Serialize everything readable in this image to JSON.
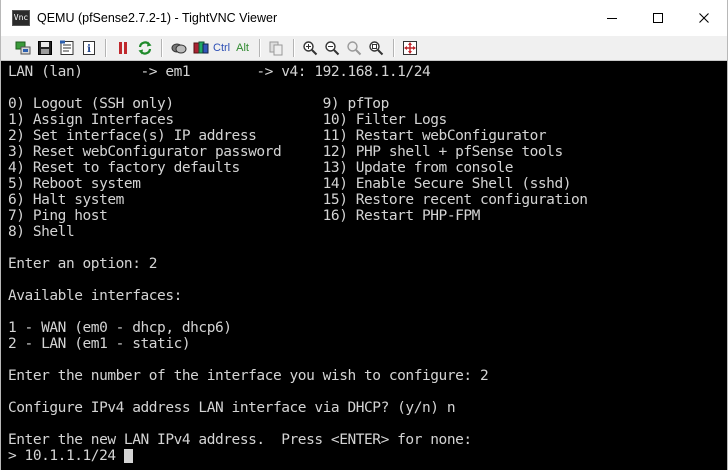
{
  "window": {
    "title": "QEMU (pfSense2.7.2-1) - TightVNC Viewer",
    "app_icon_text": "Vnc"
  },
  "toolbar": {
    "buttons": [
      "new-connection-icon",
      "save-icon",
      "options-icon",
      "info-icon",
      "pause-icon",
      "refresh-icon",
      "transfer-icon",
      "ctrl-alt-del-icon"
    ],
    "ctrl_label": "Ctrl",
    "alt_label": "Alt",
    "zoom_buttons": [
      "clipboard-icon",
      "zoom-in-icon",
      "zoom-out-icon",
      "zoom-100-icon",
      "zoom-fit-icon",
      "fullscreen-icon"
    ]
  },
  "console": {
    "lines": [
      "LAN (lan)       -> em1        -> v4: 192.168.1.1/24",
      "",
      "0) Logout (SSH only)                  9) pfTop",
      "1) Assign Interfaces                  10) Filter Logs",
      "2) Set interface(s) IP address        11) Restart webConfigurator",
      "3) Reset webConfigurator password     12) PHP shell + pfSense tools",
      "4) Reset to factory defaults          13) Update from console",
      "5) Reboot system                      14) Enable Secure Shell (sshd)",
      "6) Halt system                        15) Restore recent configuration",
      "7) Ping host                          16) Restart PHP-FPM",
      "8) Shell",
      "",
      "Enter an option: 2",
      "",
      "Available interfaces:",
      "",
      "1 - WAN (em0 - dhcp, dhcp6)",
      "2 - LAN (em1 - static)",
      "",
      "Enter the number of the interface you wish to configure: 2",
      "",
      "Configure IPv4 address LAN interface via DHCP? (y/n) n",
      "",
      "Enter the new LAN IPv4 address.  Press <ENTER> for none:",
      "> 10.1.1.1/24"
    ]
  },
  "colors": {
    "console_bg": "#000000",
    "console_fg": "#d4d4d4",
    "toolbar_bg": "#f0f0f0"
  }
}
